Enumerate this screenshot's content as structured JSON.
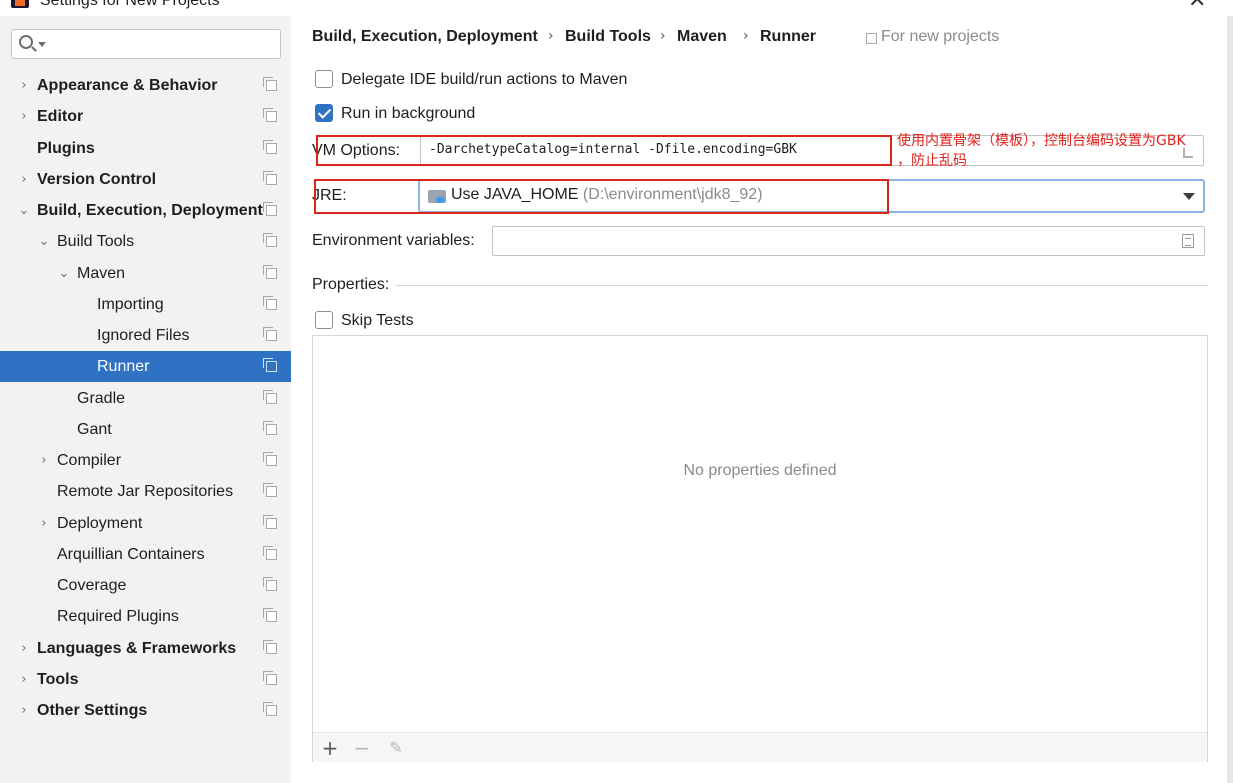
{
  "window": {
    "title": "Settings for New Projects"
  },
  "sidebar": {
    "search": {
      "value": "",
      "placeholder": ""
    },
    "items": [
      {
        "label": "Appearance & Behavior",
        "bold": true,
        "arrow": "›"
      },
      {
        "label": "Editor",
        "bold": true,
        "arrow": "›"
      },
      {
        "label": "Plugins",
        "bold": true,
        "arrow": ""
      },
      {
        "label": "Version Control",
        "bold": true,
        "arrow": "›"
      },
      {
        "label": "Build, Execution, Deployment",
        "bold": true,
        "arrow": "⌄"
      },
      {
        "label": "Build Tools",
        "bold": false,
        "arrow": "⌄"
      },
      {
        "label": "Maven",
        "bold": false,
        "arrow": "⌄"
      },
      {
        "label": "Importing",
        "bold": false,
        "arrow": ""
      },
      {
        "label": "Ignored Files",
        "bold": false,
        "arrow": ""
      },
      {
        "label": "Runner",
        "bold": false,
        "arrow": "",
        "selected": true
      },
      {
        "label": "Gradle",
        "bold": false,
        "arrow": ""
      },
      {
        "label": "Gant",
        "bold": false,
        "arrow": ""
      },
      {
        "label": "Compiler",
        "bold": false,
        "arrow": "›"
      },
      {
        "label": "Remote Jar Repositories",
        "bold": false,
        "arrow": ""
      },
      {
        "label": "Deployment",
        "bold": false,
        "arrow": "›"
      },
      {
        "label": "Arquillian Containers",
        "bold": false,
        "arrow": ""
      },
      {
        "label": "Coverage",
        "bold": false,
        "arrow": ""
      },
      {
        "label": "Required Plugins",
        "bold": false,
        "arrow": ""
      },
      {
        "label": "Languages & Frameworks",
        "bold": true,
        "arrow": "›"
      },
      {
        "label": "Tools",
        "bold": true,
        "arrow": "›"
      },
      {
        "label": "Other Settings",
        "bold": true,
        "arrow": "›"
      }
    ]
  },
  "breadcrumb": {
    "items": [
      "Build, Execution, Deployment",
      "Build Tools",
      "Maven",
      "Runner"
    ],
    "separator": "›",
    "scope": "For new projects"
  },
  "runner": {
    "delegate_label": "Delegate IDE build/run actions to Maven",
    "delegate_checked": false,
    "background_label": "Run in background",
    "background_checked": true,
    "vm_options_label": "VM Options:",
    "vm_options_value": "-DarchetypeCatalog=internal -Dfile.encoding=GBK",
    "jre_label": "JRE:",
    "jre_value": "Use JAVA_HOME",
    "jre_path": "(D:\\environment\\jdk8_92)",
    "env_label": "Environment variables:",
    "env_value": "",
    "properties_label": "Properties:",
    "skip_tests_label": "Skip Tests",
    "skip_tests_checked": false,
    "empty_properties": "No properties defined"
  },
  "toolbar": {
    "add": "+",
    "remove": "−",
    "edit": "✎"
  },
  "annotation": {
    "line1": "使用内置骨架（模板），控制台编码设置为GBK",
    "line2": "，防止乱码",
    "color": "#e0211a"
  },
  "colors": {
    "selection": "#2f72c4",
    "sidebar_bg": "#f2f2f2",
    "highlight_box": "#d9261c"
  }
}
